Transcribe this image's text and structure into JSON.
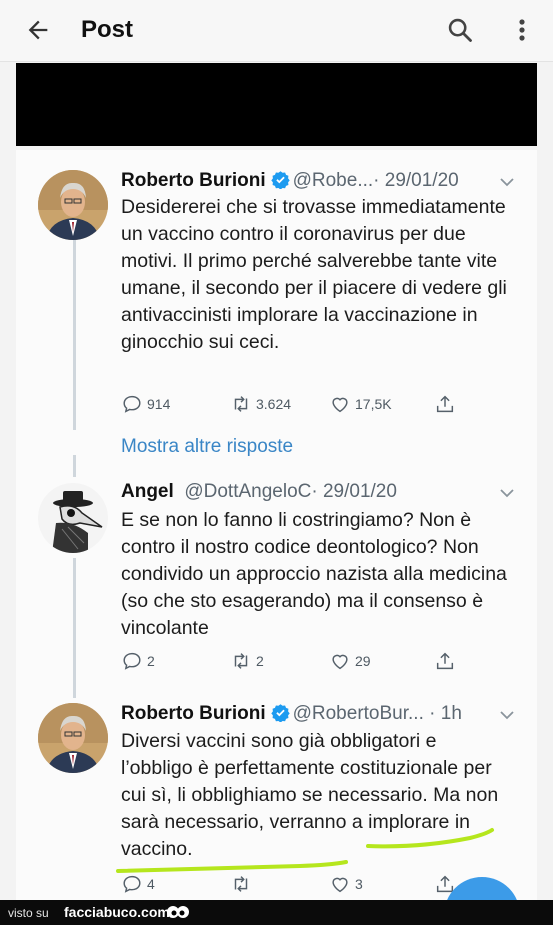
{
  "header": {
    "title": "Post"
  },
  "tweets": [
    {
      "name": "Roberto Burioni",
      "handle": "@Robe...",
      "date": "· 29/01/20",
      "text": "Desidererei che si trovasse immediatamente un vaccino contro il coronavirus per due motivi. Il primo perché salverebbe tante vite umane, il secondo per il piacere di vedere gli antivaccinisti implorare la vaccinazione in ginocchio sui ceci.",
      "replies": "914",
      "retweets": "3.624",
      "likes": "17,5K"
    },
    {
      "name": "Angel",
      "handle": "@DottAngeloC",
      "date": "· 29/01/20",
      "text": "E se non lo fanno li costringiamo? Non è contro il nostro codice deontologico? Non condivido un approccio nazista alla medicina (so che sto esagerando) ma il consenso è vincolante",
      "replies": "2",
      "retweets": "2",
      "likes": "29"
    },
    {
      "name": "Roberto Burioni",
      "handle": "@RobertoBur...",
      "date": "· 1h",
      "text": "Diversi vaccini sono già obbligatori e l’obbligo è perfettamente costituzionale per cui sì, li obblighiamo se necessario. Ma non sarà necessario, verranno a implorare in vaccino.",
      "replies": "4",
      "retweets": "",
      "likes": "3"
    }
  ],
  "show_more_replies": "Mostra altre risposte",
  "footer": {
    "visto_su": "visto su",
    "site": "facciabuco.com"
  },
  "colors": {
    "link": "#3a86c6",
    "verified": "#1d9bf0",
    "highlighter": "#b5e61d"
  }
}
